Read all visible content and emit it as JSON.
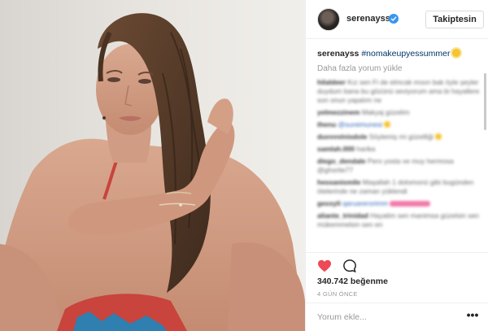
{
  "post": {
    "username": "serenayss",
    "follow_label": "Takiptesin",
    "caption_username": "serenayss",
    "caption_hashtag": "#nomakeupyessummer",
    "load_more_label": "Daha fazla yorum yükle",
    "comments": [
      {
        "user": "hilaldeer",
        "text": "Kız sen Fi de elmcak mısın bak öyle şeyler duydum bana bu gözünü seviyorum ama bi hayallere son onun yapalım ne"
      },
      {
        "user": "yelmezzinem",
        "text": "Makyaj güzelim"
      },
      {
        "user": "thenu",
        "text": "@sureimunesi",
        "emoji": true
      },
      {
        "user": "duvvvvinisdole",
        "text": "Söylemiş mi güzelliği",
        "emoji": true
      },
      {
        "user": "samlah.000",
        "text": "harika"
      },
      {
        "user": "diego_dendale",
        "text": "Pero yosta ve muy hermosa @ghorite77"
      },
      {
        "user": "hessanismile",
        "text": "Maşallah 1 dolomonü gibi bugünden ötelerinde ne zaman yüklendi"
      },
      {
        "user": "gexxyli",
        "text": "qaruarerorimm",
        "pink": true
      },
      {
        "user": "aliante_trinidad",
        "text": "Hayatim sen manimsa güzelsin sen mükemmelsin sen en"
      }
    ],
    "likes_label": "340.742 beğenme",
    "time_label": "4 GÜN ÖNCE",
    "comment_placeholder": "Yorum ekle...",
    "more_label": "•••"
  },
  "icons": {
    "verified": "verified-badge-icon",
    "like": "heart-icon",
    "comment": "comment-bubble-icon",
    "more": "more-options-icon"
  },
  "colors": {
    "heart": "#ed4956",
    "verified": "#3897f0",
    "hashtag": "#003569"
  }
}
